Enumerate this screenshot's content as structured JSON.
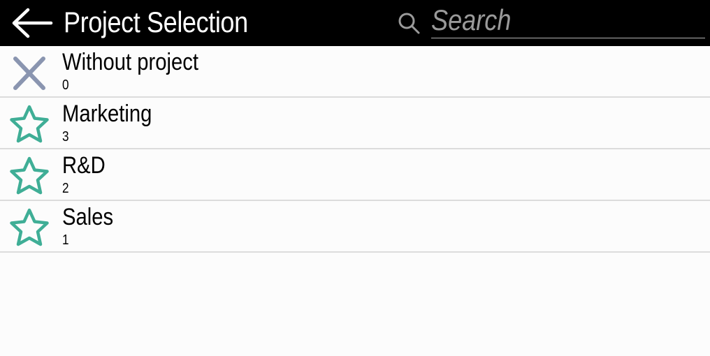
{
  "header": {
    "title": "Project Selection",
    "back_icon": "arrow-left-icon",
    "search_icon": "search-icon",
    "search_placeholder": "Search",
    "search_value": ""
  },
  "colors": {
    "header_background": "#000000",
    "header_text": "#ffffff",
    "placeholder_text": "#9a9a9a",
    "star_icon": "#3fae96",
    "no_project_icon": "#8a95b0",
    "divider": "#dcdcdc"
  },
  "projects": [
    {
      "name": "Without project",
      "count": "0",
      "icon": "close-icon"
    },
    {
      "name": "Marketing",
      "count": "3",
      "icon": "star-icon"
    },
    {
      "name": "R&D",
      "count": "2",
      "icon": "star-icon"
    },
    {
      "name": "Sales",
      "count": "1",
      "icon": "star-icon"
    }
  ]
}
